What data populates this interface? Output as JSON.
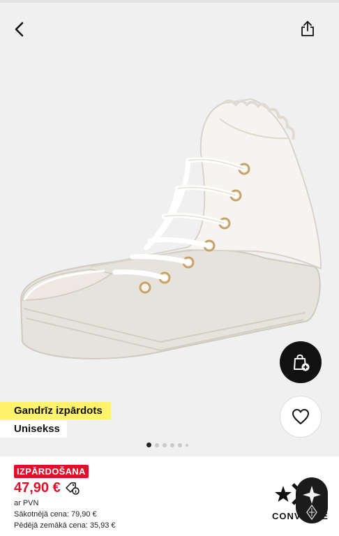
{
  "header": {
    "back_icon": "chevron-left-icon",
    "share_icon": "share-icon"
  },
  "product": {
    "image_alt": "white high-top sneaker",
    "badges": {
      "sold_out": "Gandrīz izpārdots",
      "gender": "Unisekss"
    },
    "sale_label": "IZPĀRDOŠANA",
    "price": "47,90 €",
    "vat_note": "ar PVN",
    "original_price_line": "Sākotnējā cena: 79,90 €",
    "lowest_price_line": "Pēdējā zemākā cena:  35,93 €",
    "brand": "CONVERSE"
  },
  "gallery": {
    "dots": 6,
    "active_dot": 0
  },
  "colors": {
    "sale_red": "#e0102a",
    "badge_yellow": "#fff36b",
    "background_grey": "#f0f0f0"
  }
}
